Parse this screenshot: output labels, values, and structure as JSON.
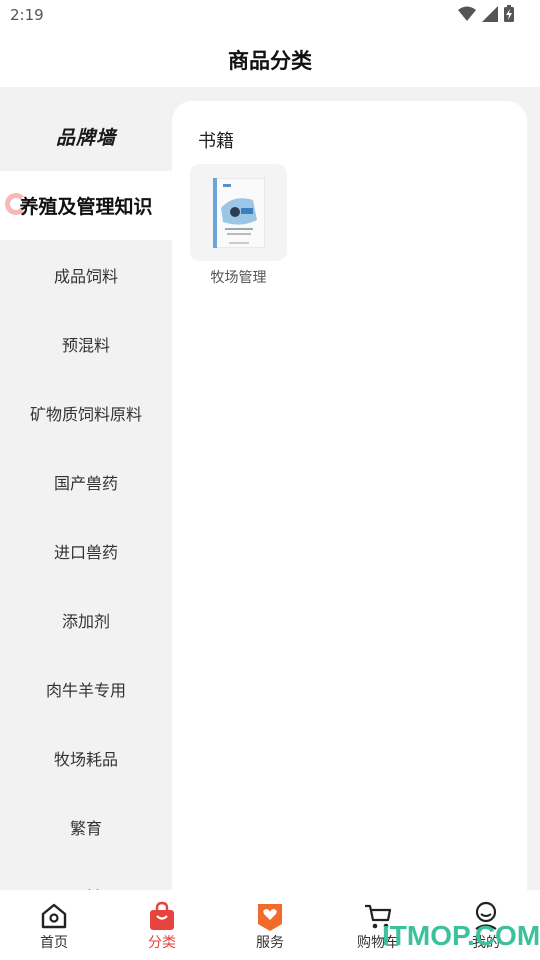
{
  "status_bar": {
    "time": "2:19"
  },
  "header": {
    "title": "商品分类"
  },
  "sidebar": {
    "brand_wall": "品牌墙",
    "items": [
      {
        "label": "养殖及管理知识",
        "active": true
      },
      {
        "label": "成品饲料"
      },
      {
        "label": "预混料"
      },
      {
        "label": "矿物质饲料原料"
      },
      {
        "label": "国产兽药"
      },
      {
        "label": "进口兽药"
      },
      {
        "label": "添加剂"
      },
      {
        "label": "肉牛羊专用"
      },
      {
        "label": "牧场耗品"
      },
      {
        "label": "繁育"
      },
      {
        "label": "器械"
      }
    ]
  },
  "panel": {
    "section_title": "书籍",
    "products": [
      {
        "name": "牧场管理"
      }
    ]
  },
  "tabbar": {
    "tabs": [
      {
        "label": "首页",
        "icon": "home-icon"
      },
      {
        "label": "分类",
        "icon": "shopping-bag-icon",
        "active": true
      },
      {
        "label": "服务",
        "icon": "heart-badge-icon"
      },
      {
        "label": "购物车",
        "icon": "cart-icon"
      },
      {
        "label": "我的",
        "icon": "user-icon"
      }
    ]
  },
  "watermark": "ITMOP.COM",
  "colors": {
    "accent": "#e8433c",
    "service_orange": "#f26b2a",
    "watermark": "#3bc29c"
  }
}
